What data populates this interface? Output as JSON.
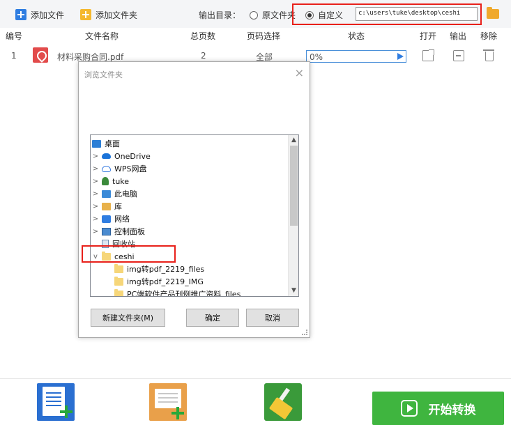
{
  "toolbar": {
    "add_file": "添加文件",
    "add_folder": "添加文件夹",
    "output_dir_label": "输出目录：",
    "radio_original": "原文件夹",
    "radio_custom": "自定义",
    "output_path": "c:\\users\\tuke\\desktop\\ceshi",
    "selected_option": "自定义"
  },
  "table": {
    "headers": [
      "编号",
      "文件名称",
      "总页数",
      "页码选择",
      "状态",
      "打开",
      "输出",
      "移除"
    ],
    "rows": [
      {
        "index": "1",
        "name": "材料采购合同.pdf",
        "pages": "2",
        "range": "全部",
        "status": "0%"
      }
    ]
  },
  "dialog": {
    "title": "浏览文件夹",
    "close": "×",
    "tree": [
      {
        "label": "桌面",
        "icon": "desktop-icon",
        "chevron": ""
      },
      {
        "label": "OneDrive",
        "icon": "cloud-icon",
        "chevron": ">"
      },
      {
        "label": "WPS网盘",
        "icon": "cloud-outline-icon",
        "chevron": ">"
      },
      {
        "label": "tuke",
        "icon": "user-icon",
        "chevron": ">"
      },
      {
        "label": "此电脑",
        "icon": "computer-icon",
        "chevron": ">"
      },
      {
        "label": "库",
        "icon": "library-icon",
        "chevron": ">"
      },
      {
        "label": "网络",
        "icon": "network-icon",
        "chevron": ">"
      },
      {
        "label": "控制面板",
        "icon": "control-panel-icon",
        "chevron": ">"
      },
      {
        "label": "回收站",
        "icon": "recycle-bin-icon",
        "chevron": ""
      },
      {
        "label": "ceshi",
        "icon": "folder-icon",
        "chevron": "v"
      },
      {
        "label": "img转pdf_2219_files",
        "icon": "folder-icon",
        "chevron": ""
      },
      {
        "label": "img转pdf_2219_IMG",
        "icon": "folder-icon",
        "chevron": ""
      },
      {
        "label": "PC端软件产品刊例推广资料_files",
        "icon": "folder-icon",
        "chevron": ""
      }
    ],
    "selected_item": "ceshi",
    "btn_new_folder": "新建文件夹(M)",
    "btn_ok": "确定",
    "btn_cancel": "取消"
  },
  "bottom": {
    "start_button": "开始转换"
  },
  "colors": {
    "accent_blue": "#2f7de1",
    "highlight_red": "#e8201a",
    "start_green": "#3fb53f"
  }
}
